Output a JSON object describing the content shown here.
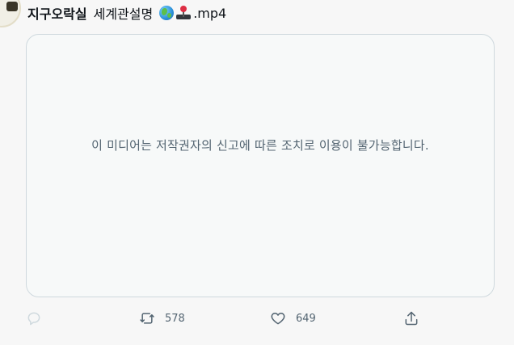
{
  "tweet": {
    "author": "지구오락실",
    "title_text": "세계관설명",
    "emojis": [
      "globe-emoji",
      "joystick-emoji"
    ],
    "file_ext": ".mp4"
  },
  "media": {
    "notice": "이 미디어는 저작권자의 신고에 따른 조치로 이용이 불가능합니다."
  },
  "actions": {
    "reply_count": "",
    "retweet_count": "578",
    "like_count": "649"
  },
  "colors": {
    "background": "#f7f7f7",
    "media_bg": "#f7f9f9",
    "border": "#cfd9de",
    "text_secondary": "#536471",
    "text_primary": "#0f1419"
  }
}
